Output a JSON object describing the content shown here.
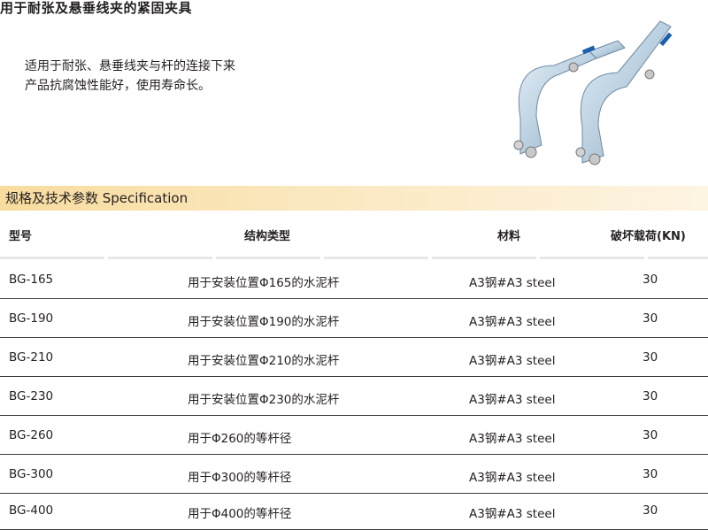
{
  "title": "用于耐张及悬垂线夹的紧固夹具",
  "description": {
    "line1": "适用于耐张、悬垂线夹与杆的连接下来",
    "line2": "产品抗腐蚀性能好，使用寿命长。"
  },
  "spec_section": {
    "title": "规格及技术参数  Specification"
  },
  "table": {
    "headers": [
      "型号",
      "结构类型",
      "材料",
      "破坏载荷(KN)"
    ],
    "rows": [
      [
        "BG-165",
        "用于安装位置Φ165的水泥杆",
        "A3钢#A3 steel",
        "30"
      ],
      [
        "BG-190",
        "用于安装位置Φ190的水泥杆",
        "A3钢#A3 steel",
        "30"
      ],
      [
        "BG-210",
        "用于安装位置Φ210的水泥杆",
        "A3钢#A3 steel",
        "30"
      ],
      [
        "BG-230",
        "用于安装位置Φ230的水泥杆",
        "A3钢#A3 steel",
        "30"
      ],
      [
        "BG-260",
        "用于Φ260的等杆径",
        "A3钢#A3 steel",
        "30"
      ],
      [
        "BG-300",
        "用于Φ300的等杆径",
        "A3钢#A3 steel",
        "30"
      ],
      [
        "BG-400",
        "用于Φ400的等杆径",
        "A3钢#A3 steel",
        "30"
      ]
    ]
  },
  "colors": {
    "spec_bar": "#f8dc9e",
    "clamp_metal": "#b9cfe0",
    "label_blue": "#1d5fae"
  }
}
